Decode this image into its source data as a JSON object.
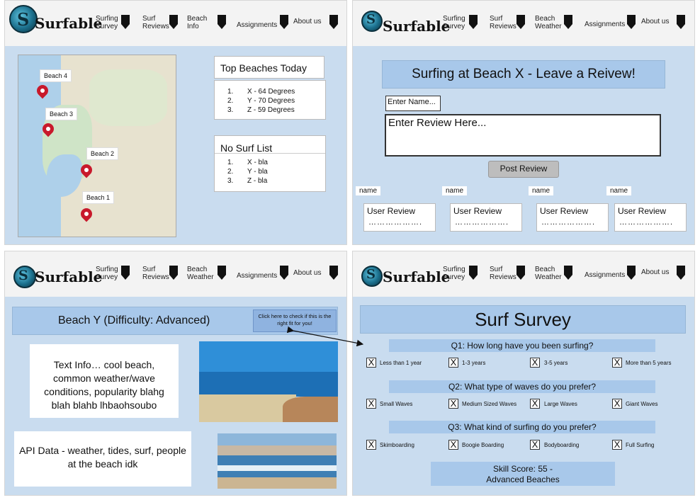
{
  "brand": {
    "logo_letter": "S",
    "name": "Surfable"
  },
  "nav_a": [
    {
      "line1": "Surfing",
      "line2": "Survey"
    },
    {
      "line1": "Surf",
      "line2": "Reviews"
    },
    {
      "line1": "Beach",
      "line2": "Info"
    },
    {
      "line1": "Assignments",
      "line2": ""
    },
    {
      "line1": "About us",
      "line2": ""
    }
  ],
  "nav_b": [
    {
      "line1": "Surfing",
      "line2": "Survey"
    },
    {
      "line1": "Surf",
      "line2": "Reviews"
    },
    {
      "line1": "Beach",
      "line2": "Weather"
    },
    {
      "line1": "Assignments",
      "line2": ""
    },
    {
      "line1": "About us",
      "line2": ""
    }
  ],
  "panel1": {
    "beaches": [
      "Beach 4",
      "Beach 3",
      "Beach 2",
      "Beach 1"
    ],
    "top_title": "Top Beaches Today",
    "top_list": [
      "X - 64 Degrees",
      "Y - 70 Degrees",
      "Z - 59 Degrees"
    ],
    "nosurf_title": "No Surf List",
    "nosurf_list": [
      "X - bla",
      "Y - bla",
      "Z - bla"
    ]
  },
  "panel2": {
    "header": "Surfing at Beach X - Leave a Reivew!",
    "name_placeholder": "Enter Name...",
    "review_placeholder": "Enter Review Here...",
    "post_label": "Post Review",
    "reviews": [
      {
        "name": "name",
        "title": "User Review",
        "dots": "………………."
      },
      {
        "name": "name",
        "title": "User Review",
        "dots": "………………."
      },
      {
        "name": "name",
        "title": "User Review",
        "dots": "………………."
      },
      {
        "name": "name",
        "title": "User Review",
        "dots": "………………."
      }
    ]
  },
  "panel3": {
    "header": "Beach Y (Difficulty: Advanced)",
    "fit_button": "Click here to check if this is the right fit for you!",
    "text_info": "Text Info… cool beach, common weather/wave conditions, popularity blahg blah blahb lhbaohsoubo",
    "api_data": "API Data - weather, tides, surf, people at the beach idk"
  },
  "panel4": {
    "title": "Surf Survey",
    "questions": [
      {
        "q": "Q1: How long have you been surfing?",
        "options": [
          "Less than 1 year",
          "1-3 years",
          "3-5 years",
          "More than 5 years"
        ]
      },
      {
        "q": "Q2: What type of waves do you prefer?",
        "options": [
          "Small Waves",
          "Medium Sized Waves",
          "Large Waves",
          "Giant Waves"
        ]
      },
      {
        "q": "Q3: What kind of surfing do you prefer?",
        "options": [
          "Skimboarding",
          "Boogie Boarding",
          "Bodyboarding",
          "Full Surfing"
        ]
      }
    ],
    "mark": "X",
    "score_line1": "Skill Score: 55 -",
    "score_line2": "Advanced Beaches"
  }
}
